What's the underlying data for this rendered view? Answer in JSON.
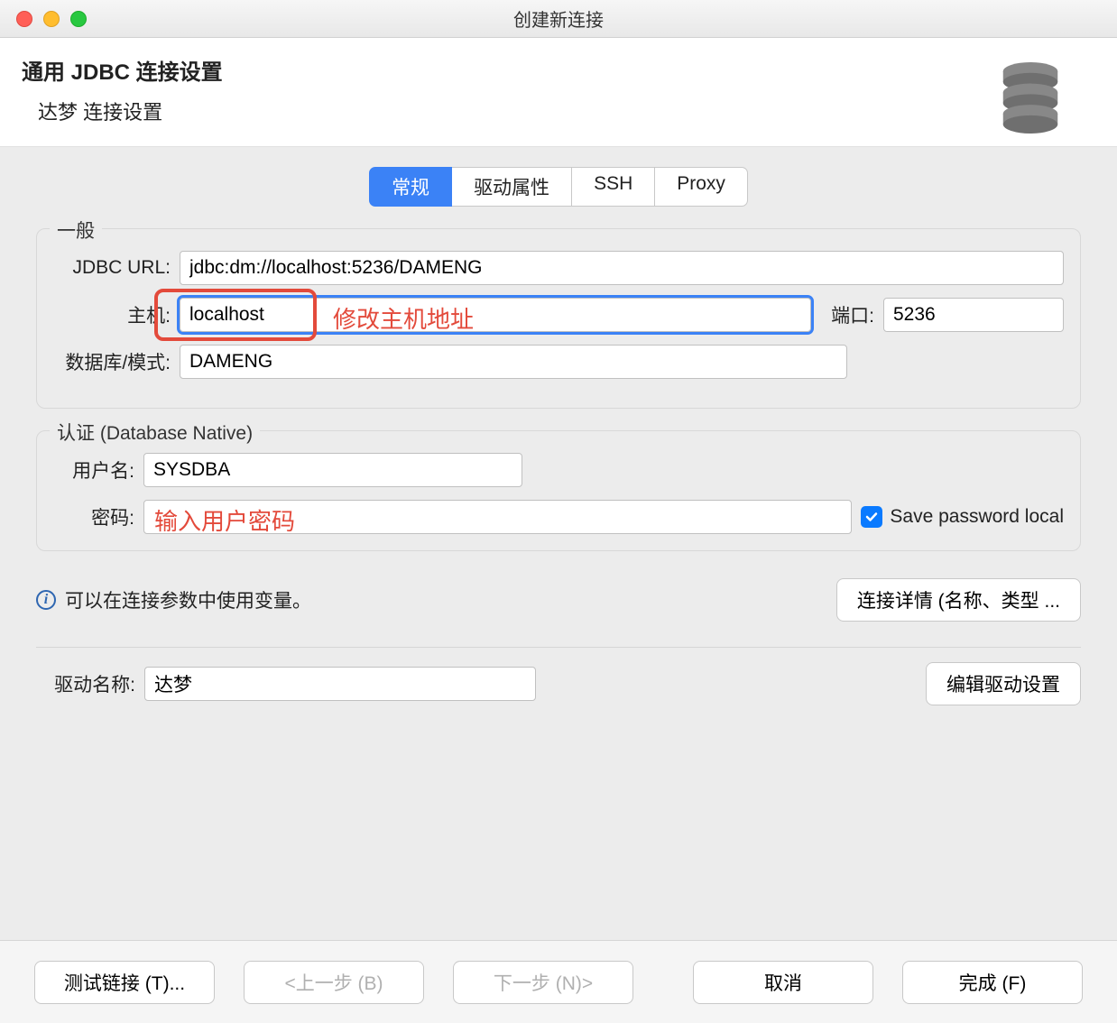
{
  "window": {
    "title": "创建新连接"
  },
  "header": {
    "title": "通用 JDBC 连接设置",
    "subtitle": "达梦 连接设置"
  },
  "tabs": {
    "general": "常规",
    "driver_props": "驱动属性",
    "ssh": "SSH",
    "proxy": "Proxy"
  },
  "general_group": {
    "legend": "一般",
    "jdbc_url_label": "JDBC URL:",
    "jdbc_url_value": "jdbc:dm://localhost:5236/DAMENG",
    "host_label": "主机:",
    "host_value": "localhost",
    "port_label": "端口:",
    "port_value": "5236",
    "db_label": "数据库/模式:",
    "db_value": "DAMENG"
  },
  "auth_group": {
    "legend": "认证 (Database Native)",
    "user_label": "用户名:",
    "user_value": "SYSDBA",
    "pwd_label": "密码:",
    "pwd_value": "",
    "save_pwd_label": "Save password local"
  },
  "info": {
    "text": "可以在连接参数中使用变量。",
    "details_btn": "连接详情 (名称、类型 ..."
  },
  "driver": {
    "label": "驱动名称:",
    "value": "达梦",
    "edit_btn": "编辑驱动设置"
  },
  "buttons": {
    "test": "测试链接 (T)...",
    "back": "<上一步 (B)",
    "next": "下一步 (N)>",
    "cancel": "取消",
    "finish": "完成 (F)"
  },
  "annotations": {
    "host_hint": "修改主机地址",
    "pwd_hint": "输入用户密码"
  }
}
